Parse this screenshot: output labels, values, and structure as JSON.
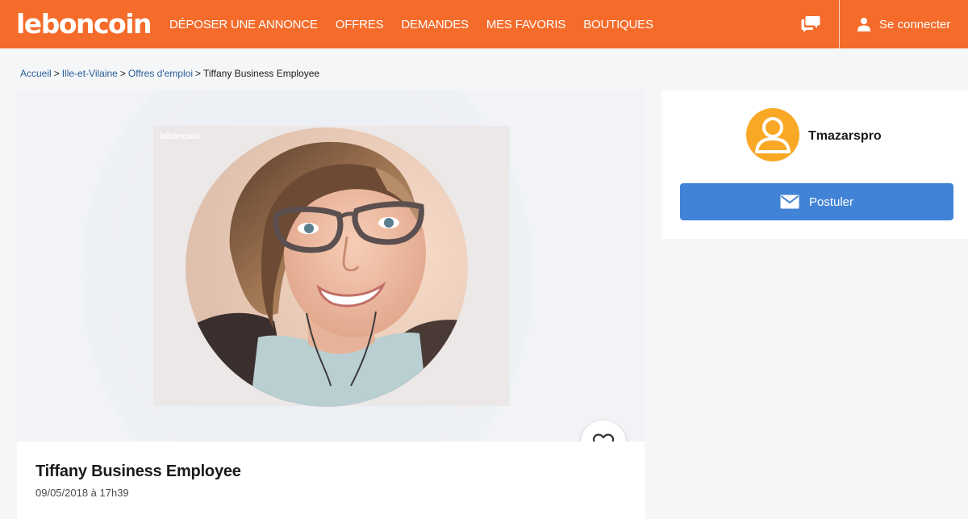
{
  "header": {
    "logo": "leboncoin",
    "nav": [
      "DÉPOSER UNE ANNONCE",
      "OFFRES",
      "DEMANDES",
      "MES FAVORIS",
      "BOUTIQUES"
    ],
    "login_label": "Se connecter",
    "messages_icon": "chat-bubbles-icon",
    "user_icon": "person-icon"
  },
  "breadcrumb": {
    "items": [
      "Accueil",
      "Ille-et-Vilaine",
      "Offres d'emploi"
    ],
    "current": "Tiffany Business Employee",
    "separator": ">"
  },
  "photo": {
    "watermark": "leboncoin"
  },
  "ad": {
    "title": "Tiffany Business Employee",
    "date": "09/05/2018 à 17h39"
  },
  "seller": {
    "name": "Tmazarspro",
    "apply_label": "Postuler",
    "apply_icon": "envelope-icon",
    "avatar_icon": "person-avatar-icon"
  },
  "favorite_icon": "heart-icon",
  "colors": {
    "brand": "#f56b2a",
    "button": "#4183d7",
    "avatar": "#f9a825",
    "link": "#2b5d9b"
  }
}
